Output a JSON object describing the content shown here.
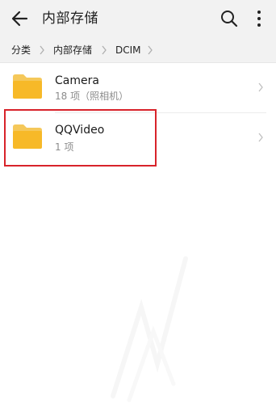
{
  "app_bar": {
    "title": "内部存储",
    "back_icon": "arrow-left-icon",
    "search_icon": "search-icon",
    "more_icon": "more-vertical-icon"
  },
  "breadcrumb": {
    "items": [
      "分类",
      "内部存储",
      "DCIM"
    ]
  },
  "folders": [
    {
      "name": "Camera",
      "subtitle": "18 项（照相机）"
    },
    {
      "name": "QQVideo",
      "subtitle": "1 项"
    }
  ],
  "colors": {
    "app_bar_bg": "#f2f2f2",
    "folder_yellow": "#f7b928",
    "highlight_red": "#d8232a"
  }
}
